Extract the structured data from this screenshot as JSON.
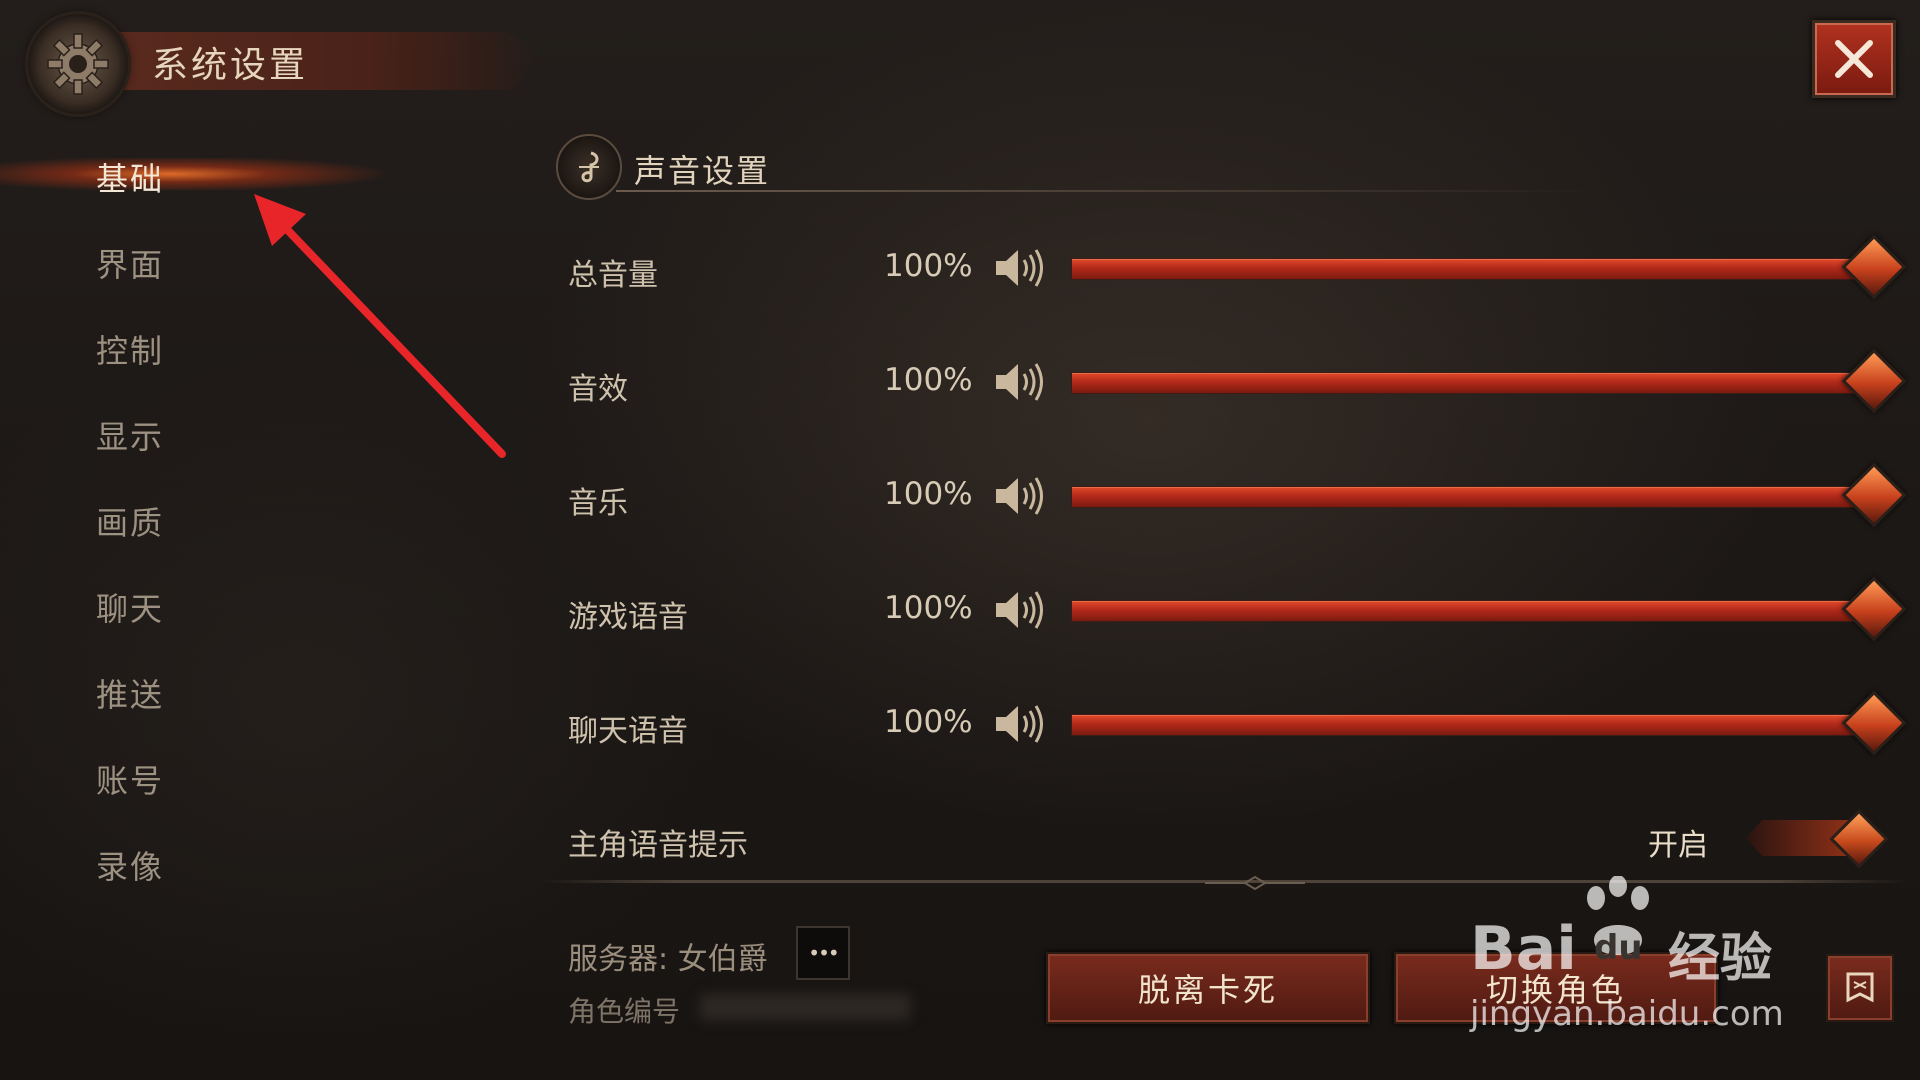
{
  "window": {
    "title": "系统设置",
    "close_icon": "close-icon"
  },
  "nav": {
    "items": [
      {
        "label": "基础",
        "active": true
      },
      {
        "label": "界面"
      },
      {
        "label": "控制"
      },
      {
        "label": "显示"
      },
      {
        "label": "画质"
      },
      {
        "label": "聊天"
      },
      {
        "label": "推送"
      },
      {
        "label": "账号"
      },
      {
        "label": "录像"
      }
    ]
  },
  "section": {
    "title": "声音设置",
    "icon": "music-note-icon"
  },
  "sliders": [
    {
      "label": "总音量",
      "value_text": "100%",
      "value": 1.0
    },
    {
      "label": "音效",
      "value_text": "100%",
      "value": 1.0
    },
    {
      "label": "音乐",
      "value_text": "100%",
      "value": 1.0
    },
    {
      "label": "游戏语音",
      "value_text": "100%",
      "value": 1.0
    },
    {
      "label": "聊天语音",
      "value_text": "100%",
      "value": 1.0
    }
  ],
  "toggle": {
    "label": "主角语音提示",
    "state_text": "开启",
    "on": true
  },
  "footer": {
    "server_label": "服务器: 女伯爵",
    "server_more": "•••",
    "role_label": "角色编号",
    "buttons": {
      "unstuck": "脱离卡死",
      "switch_role": "切换角色"
    }
  },
  "watermark": {
    "brand": "Bai",
    "brand2": "du",
    "text": "经验",
    "url": "jingyan.baidu.com"
  },
  "colors": {
    "accent": "#c23a1e",
    "annotation_arrow": "#e8262a"
  }
}
